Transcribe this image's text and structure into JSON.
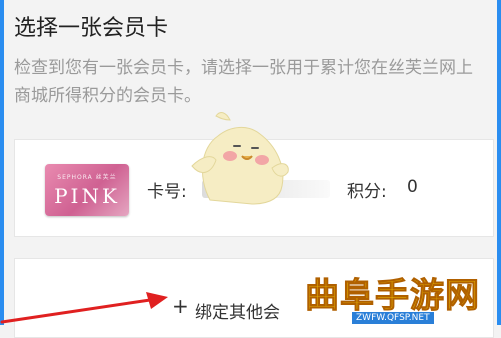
{
  "page": {
    "title": "选择一张会员卡",
    "description": "检查到您有一张会员卡，请选择一张用于累计您在丝芙兰网上商城所得积分的会员卡。"
  },
  "card": {
    "brand_text": "SEPHORA 丝芙兰",
    "name": "PINK",
    "number_label": "卡号:",
    "points_label": "积分:",
    "points_value": "0"
  },
  "bind": {
    "plus": "+",
    "label": "绑定其他会"
  },
  "watermark": {
    "title": "曲阜手游网",
    "url": "ZWFW.QFSP.NET"
  },
  "colors": {
    "accent": "#2a8df0",
    "card_pink": "#cf6192",
    "arrow_red": "#e02020",
    "watermark_yellow": "#f0c000"
  }
}
